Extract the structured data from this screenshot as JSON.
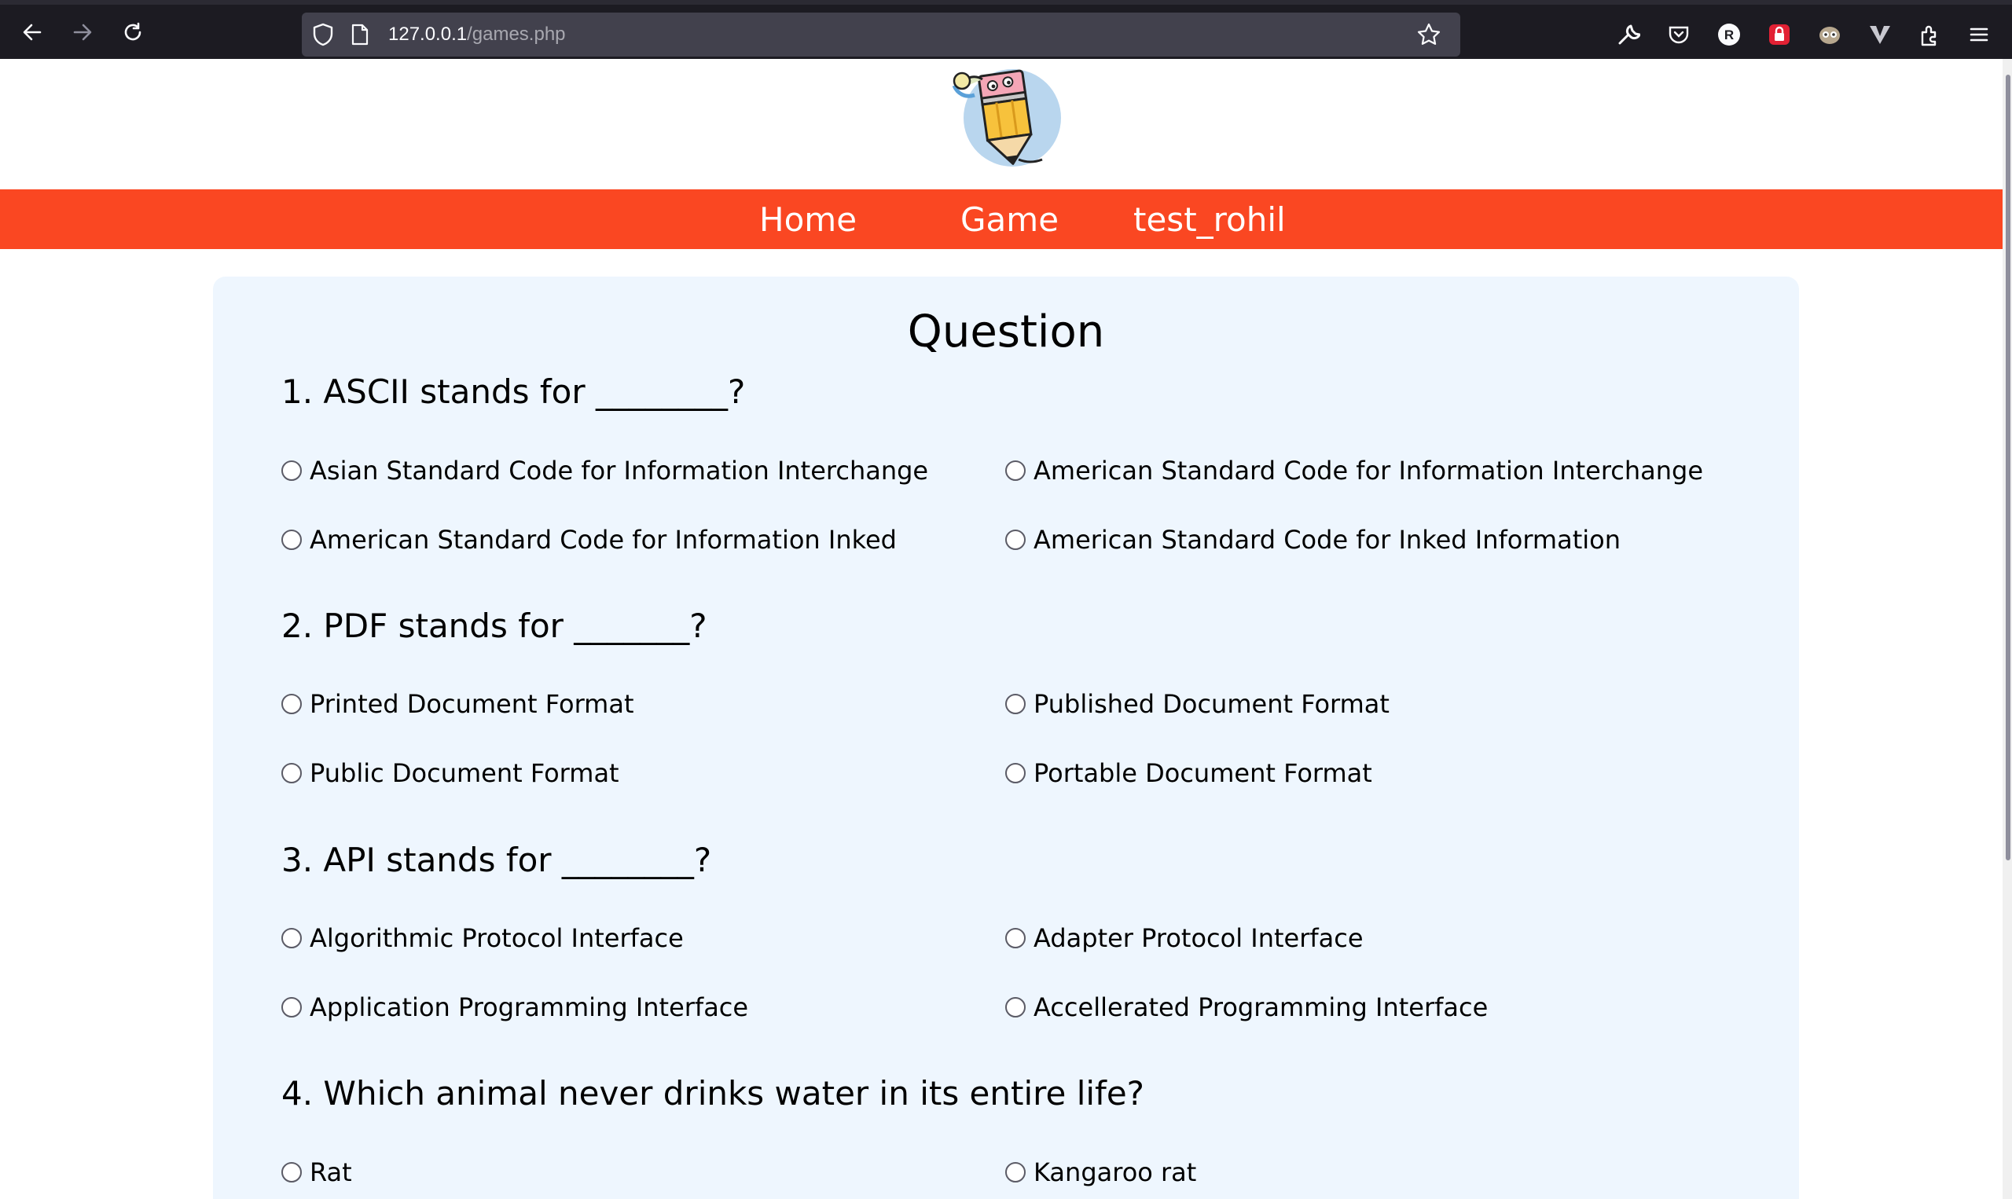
{
  "browser": {
    "url_host": "127.0.0.1",
    "url_path": "/games.php",
    "icons": [
      "back-icon",
      "forward-icon",
      "reload-icon",
      "shield-icon",
      "page-icon",
      "bookmark-star-icon",
      "wrench-icon",
      "pocket-icon",
      "profile-r-icon",
      "lock-extension-icon",
      "mask-extension-icon",
      "v-extension-icon",
      "extensions-icon",
      "menu-icon"
    ]
  },
  "nav": {
    "home": "Home",
    "game": "Game",
    "user": "test_rohil"
  },
  "quiz": {
    "title": "Question",
    "questions": [
      {
        "text": "1. ASCII stands for ________?",
        "options": [
          "Asian Standard Code for Information Interchange",
          "American Standard Code for Information Interchange",
          "American Standard Code for Information Inked",
          "American Standard Code for Inked Information"
        ]
      },
      {
        "text": "2. PDF stands for _______?",
        "options": [
          "Printed Document Format",
          "Published Document Format",
          "Public Document Format",
          "Portable Document Format"
        ]
      },
      {
        "text": "3. API stands for ________?",
        "options": [
          "Algorithmic Protocol Interface",
          "Adapter Protocol Interface",
          "Application Programming Interface",
          "Accellerated Programming Interface"
        ]
      },
      {
        "text": "4. Which animal never drinks water in its entire life?",
        "options": [
          "Rat",
          "Kangaroo rat"
        ]
      }
    ]
  },
  "colors": {
    "navbar": "#fa4722",
    "card": "#eef6fe",
    "chrome": "#1c1b22"
  }
}
